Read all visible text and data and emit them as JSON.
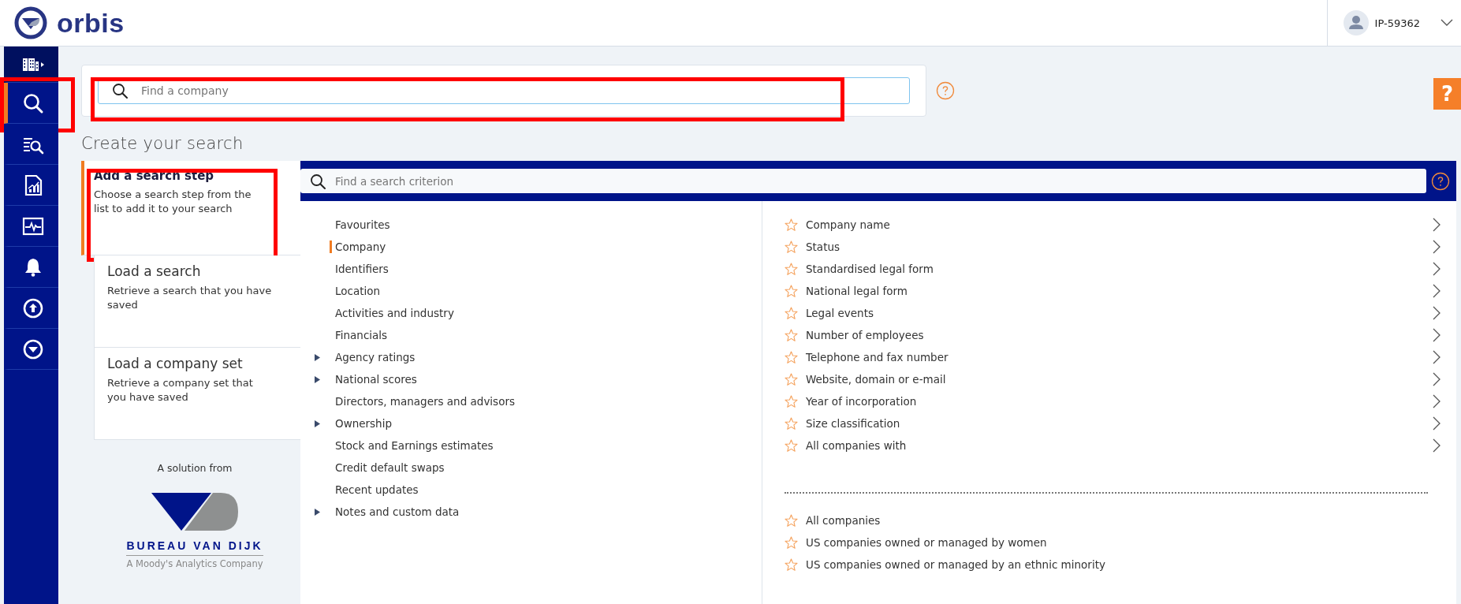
{
  "header": {
    "logo_text": "orbis",
    "user": "IP-59362"
  },
  "sidebar": {
    "items": [
      {
        "kind": "companies",
        "selected": false,
        "highlighted": false
      },
      {
        "kind": "search",
        "selected": true,
        "highlighted": true
      },
      {
        "kind": "searchlist",
        "selected": false,
        "highlighted": false
      },
      {
        "kind": "report",
        "selected": false,
        "highlighted": false
      },
      {
        "kind": "monitor",
        "selected": false,
        "highlighted": false
      },
      {
        "kind": "alerts",
        "selected": false,
        "highlighted": false
      },
      {
        "kind": "upload",
        "selected": false,
        "highlighted": false
      },
      {
        "kind": "orbis",
        "selected": false,
        "highlighted": false
      }
    ]
  },
  "company_search": {
    "placeholder": "Find a company",
    "highlighted": true
  },
  "help_tab": {
    "label": "?"
  },
  "title": "Create your search",
  "steps": [
    {
      "title": "Add a search step",
      "description": "Choose a search step from the list to add it to your search",
      "selected": true,
      "highlighted": true
    },
    {
      "title": "Load a search",
      "description": "Retrieve a search that you have saved",
      "selected": false,
      "highlighted": false
    },
    {
      "title": "Load a company set",
      "description": "Retrieve a company set that you have saved",
      "selected": false,
      "highlighted": false
    }
  ],
  "branding": {
    "caption": "A solution from",
    "company": "BUREAU VAN DIJK",
    "tagline": "A Moody's Analytics Company"
  },
  "criterion_search": {
    "placeholder": "Find a search criterion"
  },
  "categories": [
    {
      "label": "Favourites",
      "selected": false,
      "expandable": false
    },
    {
      "label": "Company",
      "selected": true,
      "expandable": false
    },
    {
      "label": "Identifiers",
      "selected": false,
      "expandable": false
    },
    {
      "label": "Location",
      "selected": false,
      "expandable": false
    },
    {
      "label": "Activities and industry",
      "selected": false,
      "expandable": false
    },
    {
      "label": "Financials",
      "selected": false,
      "expandable": false
    },
    {
      "label": "Agency ratings",
      "selected": false,
      "expandable": true
    },
    {
      "label": "National scores",
      "selected": false,
      "expandable": true
    },
    {
      "label": "Directors, managers and advisors",
      "selected": false,
      "expandable": false
    },
    {
      "label": "Ownership",
      "selected": false,
      "expandable": true
    },
    {
      "label": "Stock and Earnings estimates",
      "selected": false,
      "expandable": false
    },
    {
      "label": "Credit default swaps",
      "selected": false,
      "expandable": false
    },
    {
      "label": "Recent updates",
      "selected": false,
      "expandable": false
    },
    {
      "label": "Notes and custom data",
      "selected": false,
      "expandable": true
    }
  ],
  "criteria": [
    {
      "label": "Company name",
      "favourite": false
    },
    {
      "label": "Status",
      "favourite": false
    },
    {
      "label": "Standardised legal form",
      "favourite": false
    },
    {
      "label": "National legal form",
      "favourite": false
    },
    {
      "label": "Legal events",
      "favourite": false
    },
    {
      "label": "Number of employees",
      "favourite": false
    },
    {
      "label": "Telephone and fax number",
      "favourite": false
    },
    {
      "label": "Website, domain or e-mail",
      "favourite": false
    },
    {
      "label": "Year of incorporation",
      "favourite": false
    },
    {
      "label": "Size classification",
      "favourite": false
    },
    {
      "label": "All companies with",
      "favourite": false
    }
  ],
  "presets": [
    {
      "label": "All companies",
      "favourite": false
    },
    {
      "label": "US companies owned or managed by women",
      "favourite": false
    },
    {
      "label": "US companies owned or managed by an ethnic minority",
      "favourite": false
    }
  ]
}
